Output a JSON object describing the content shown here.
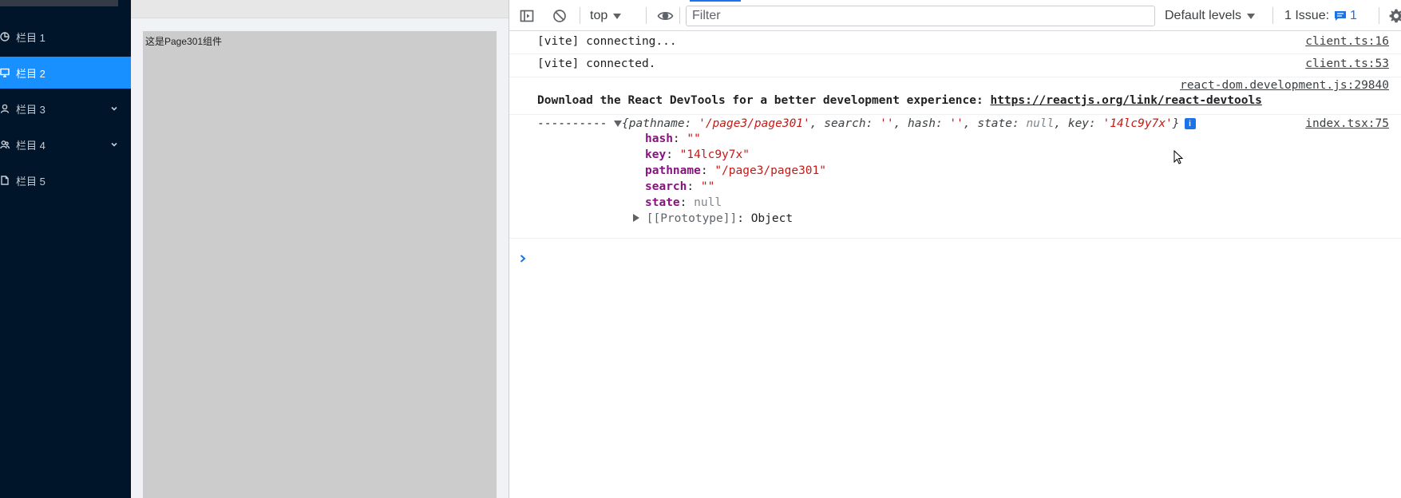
{
  "sidebar": {
    "items": [
      {
        "label": "栏目 1",
        "icon": "pie-chart-icon",
        "active": false,
        "expandable": false
      },
      {
        "label": "栏目 2",
        "icon": "desktop-icon",
        "active": true,
        "expandable": false
      },
      {
        "label": "栏目 3",
        "icon": "user-icon",
        "active": false,
        "expandable": true
      },
      {
        "label": "栏目 4",
        "icon": "team-icon",
        "active": false,
        "expandable": true
      },
      {
        "label": "栏目 5",
        "icon": "file-icon",
        "active": false,
        "expandable": false
      }
    ],
    "bg_color": "#001529",
    "active_color": "#1890ff"
  },
  "page": {
    "text": "这是Page301组件"
  },
  "devtools": {
    "toolbar": {
      "context": "top",
      "filter_placeholder": "Filter",
      "levels": "Default levels",
      "issues_label": "1 Issue:",
      "issues_count": "1"
    },
    "console": {
      "rows": [
        {
          "message": "[vite] connecting...",
          "source": "client.ts:16"
        },
        {
          "message": "[vite] connected.",
          "source": "client.ts:53"
        },
        {
          "message": "Download the React DevTools for a better development experience: ",
          "link": "https://reactjs.org/link/react-devtools",
          "source": "react-dom.development.js:29840"
        }
      ],
      "object_log": {
        "prefix": "----------",
        "source": "index.tsx:75",
        "preview": {
          "open": "{",
          "k1": "pathname: ",
          "v1": "'/page3/page301'",
          "k2": ", search: ",
          "v2": "''",
          "k3": ", hash: ",
          "v3": "''",
          "k4": ", state: ",
          "v4": "null",
          "k5": ", key: ",
          "v5": "'14lc9y7x'",
          "close": "}"
        },
        "properties": [
          {
            "key": "hash",
            "value": "\"\"",
            "type": "string"
          },
          {
            "key": "key",
            "value": "\"14lc9y7x\"",
            "type": "string"
          },
          {
            "key": "pathname",
            "value": "\"/page3/page301\"",
            "type": "string"
          },
          {
            "key": "search",
            "value": "\"\"",
            "type": "string"
          },
          {
            "key": "state",
            "value": "null",
            "type": "null"
          }
        ],
        "prototype_label": "[[Prototype]]",
        "prototype_value": ": Object"
      }
    }
  }
}
